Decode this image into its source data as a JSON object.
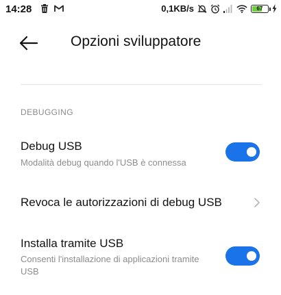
{
  "status_bar": {
    "time": "14:28",
    "network_speed": "0,1KB/s",
    "battery_level": "67",
    "battery_percent": 67,
    "icons": [
      "trash-icon",
      "gmail-icon",
      "mute-icon",
      "alarm-icon",
      "signal-icon",
      "wifi-icon",
      "battery-icon",
      "charging-icon"
    ]
  },
  "header": {
    "title": "Opzioni sviluppatore",
    "back_icon": "arrow-left-icon"
  },
  "section": {
    "header": "DEBUGGING"
  },
  "items": [
    {
      "title": "Debug USB",
      "subtitle": "Modalità debug quando l'USB è connessa",
      "control": "toggle",
      "enabled": true
    },
    {
      "title": "Revoca le autorizzazioni di debug USB",
      "control": "chevron"
    },
    {
      "title": "Installa tramite USB",
      "subtitle": "Consenti l'installazione di applicazioni tramite USB",
      "control": "toggle",
      "enabled": true
    }
  ],
  "colors": {
    "accent": "#1a73e8",
    "battery_fill": "#6fcf3b",
    "subtitle_text": "#8d8d8d",
    "section_text": "#8a8a8a"
  }
}
